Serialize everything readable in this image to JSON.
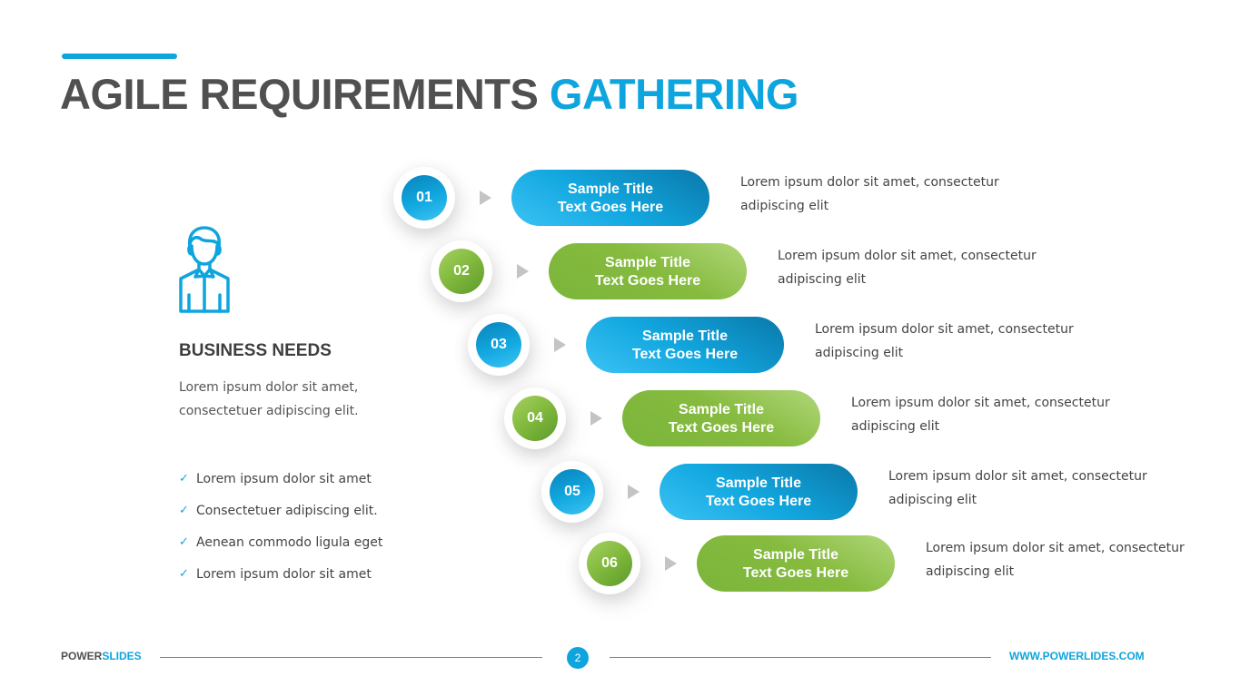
{
  "header": {
    "title_part1": "AGILE REQUIREMENTS",
    "title_part2": "GATHERING",
    "accent_color": "#0ea5de"
  },
  "left_panel": {
    "icon": "person-icon",
    "title": "BUSINESS NEEDS",
    "description": "Lorem ipsum dolor sit amet, consectetuer adipiscing elit.",
    "checklist": [
      "Lorem ipsum dolor sit amet",
      "Consectetuer adipiscing elit.",
      "Aenean commodo ligula eget",
      "Lorem ipsum dolor sit amet"
    ]
  },
  "steps": [
    {
      "number": "01",
      "color": "blue",
      "title": "Sample Title Text Goes Here",
      "description": "Lorem ipsum dolor sit amet, consectetur adipiscing elit"
    },
    {
      "number": "02",
      "color": "green",
      "title": "Sample Title Text Goes Here",
      "description": "Lorem ipsum dolor sit amet, consectetur adipiscing elit"
    },
    {
      "number": "03",
      "color": "blue",
      "title": "Sample Title Text Goes Here",
      "description": "Lorem ipsum dolor sit amet, consectetur adipiscing elit"
    },
    {
      "number": "04",
      "color": "green",
      "title": "Sample Title Text Goes Here",
      "description": "Lorem ipsum dolor sit amet, consectetur adipiscing elit"
    },
    {
      "number": "05",
      "color": "blue",
      "title": "Sample Title Text Goes Here",
      "description": "Lorem ipsum dolor sit amet, consectetur adipiscing elit"
    },
    {
      "number": "06",
      "color": "green",
      "title": "Sample Title Text Goes Here",
      "description": "Lorem ipsum dolor sit amet, consectetur adipiscing elit"
    }
  ],
  "colors": {
    "blue": "#0ea5de",
    "green": "#86bb3f"
  },
  "footer": {
    "brand_part1": "POWER",
    "brand_part2": "SLIDES",
    "page_number": "2",
    "url": "WWW.POWERLIDES.COM"
  }
}
